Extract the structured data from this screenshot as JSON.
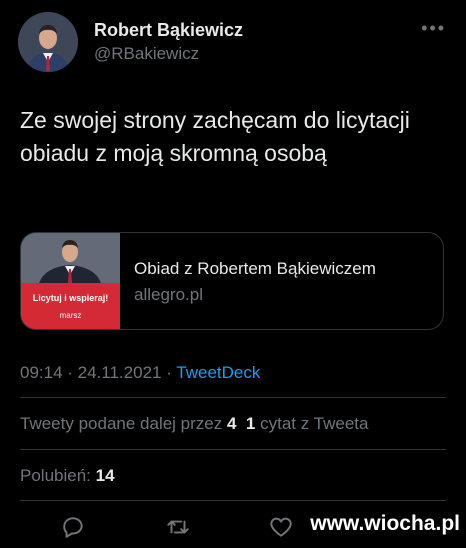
{
  "author": {
    "name": "Robert Bąkiewicz",
    "handle": "@RBakiewicz"
  },
  "tweet": {
    "text": "Ze swojej strony zachęcam do licytacji obiadu z moją skromną osobą"
  },
  "card": {
    "title": "Obiad z Robertem Bąkiewiczem",
    "domain": "allegro.pl",
    "banner_text": "Licytuj i wspieraj!",
    "banner_logo": "marsz"
  },
  "meta": {
    "time": "09:14",
    "sep1": " · ",
    "date": "24.11.2021",
    "sep2": " · ",
    "source": "TweetDeck"
  },
  "stats": {
    "retweets_label": "Tweety podane dalej przez",
    "retweets_count": "4",
    "quotes_count": "1",
    "quotes_label": "cytat z Tweeta",
    "likes_label": "Polubień:",
    "likes_count": "14"
  },
  "actions": [
    "reply-icon",
    "retweet-icon",
    "like-icon"
  ],
  "watermark": "www.wiocha.pl",
  "colors": {
    "background": "#000000",
    "text": "#e7e9ea",
    "muted": "#71767b",
    "link": "#1d9bf0",
    "banner": "#d42a36"
  }
}
